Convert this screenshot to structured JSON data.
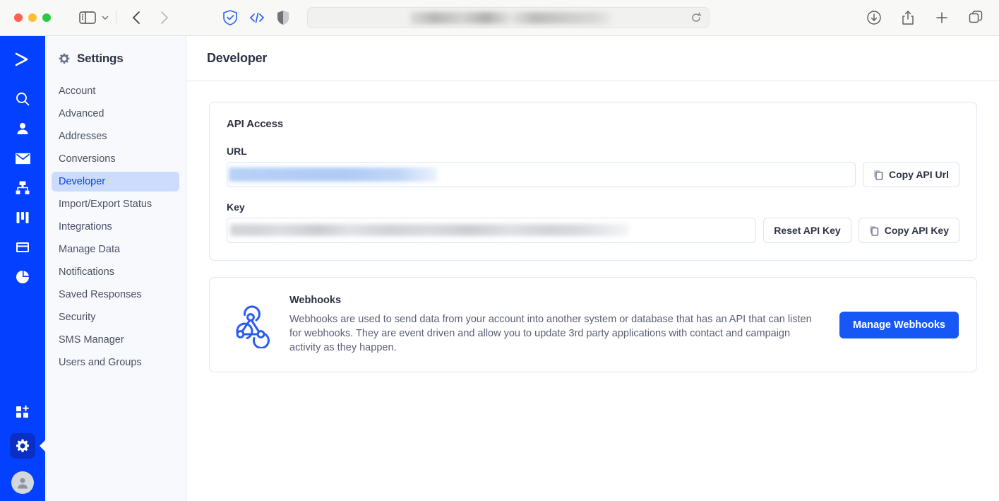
{
  "browser": {
    "traffic_lights": [
      "close",
      "minimize",
      "zoom"
    ],
    "sidebar_toggle": "sidebar-toggle",
    "tab_group_chevron": "chevron-down",
    "back": "back",
    "forward": "forward",
    "shield_check": "shield-check-icon",
    "code": "code-icon",
    "privacy_report": "privacy-report-icon",
    "address_value": "",
    "address_placeholder": "",
    "reload": "reload-icon",
    "downloads": "downloads-icon",
    "share": "share-icon",
    "new_tab": "new-tab-icon",
    "tab_overview": "tab-overview-icon"
  },
  "app_rail": {
    "logo": "activecampaign-logo",
    "items": [
      {
        "name": "search",
        "icon": "search-icon"
      },
      {
        "name": "contacts",
        "icon": "person-icon"
      },
      {
        "name": "campaigns",
        "icon": "envelope-icon"
      },
      {
        "name": "automations",
        "icon": "hierarchy-icon"
      },
      {
        "name": "deals",
        "icon": "kanban-icon"
      },
      {
        "name": "pages",
        "icon": "window-icon"
      },
      {
        "name": "reports",
        "icon": "pie-chart-icon"
      }
    ],
    "apps": {
      "name": "add-app",
      "icon": "apps-plus-icon"
    },
    "settings": {
      "name": "settings",
      "icon": "gear-icon",
      "active": true
    },
    "avatar": {
      "name": "account-avatar",
      "icon": "person-circle-icon"
    },
    "accent_color": "#0340ff",
    "active_color": "#0a2fc4"
  },
  "settings_panel": {
    "title": "Settings",
    "gear_icon": "gear-icon",
    "items": [
      {
        "label": "Account",
        "active": false
      },
      {
        "label": "Advanced",
        "active": false
      },
      {
        "label": "Addresses",
        "active": false
      },
      {
        "label": "Conversions",
        "active": false
      },
      {
        "label": "Developer",
        "active": true
      },
      {
        "label": "Import/Export Status",
        "active": false
      },
      {
        "label": "Integrations",
        "active": false
      },
      {
        "label": "Manage Data",
        "active": false
      },
      {
        "label": "Notifications",
        "active": false
      },
      {
        "label": "Saved Responses",
        "active": false
      },
      {
        "label": "Security",
        "active": false
      },
      {
        "label": "SMS Manager",
        "active": false
      },
      {
        "label": "Users and Groups",
        "active": false
      }
    ],
    "active_bg": "#cddcfd",
    "active_text": "#0340ff"
  },
  "page": {
    "title": "Developer"
  },
  "api_access": {
    "heading": "API Access",
    "url_label": "URL",
    "url_value": "",
    "url_placeholder": "",
    "copy_url_label": "Copy API Url",
    "copy_url_icon": "copy-icon",
    "key_label": "Key",
    "key_value": "",
    "key_placeholder": "",
    "reset_key_label": "Reset API Key",
    "copy_key_label": "Copy API Key",
    "copy_key_icon": "copy-icon"
  },
  "webhooks": {
    "icon": "webhook-icon",
    "title": "Webhooks",
    "description": "Webhooks are used to send data from your account into another system or database that has an API that can listen for webhooks. They are event driven and allow you to update 3rd party applications with contact and campaign activity as they happen.",
    "button_label": "Manage Webhooks",
    "button_color": "#1757f5"
  }
}
